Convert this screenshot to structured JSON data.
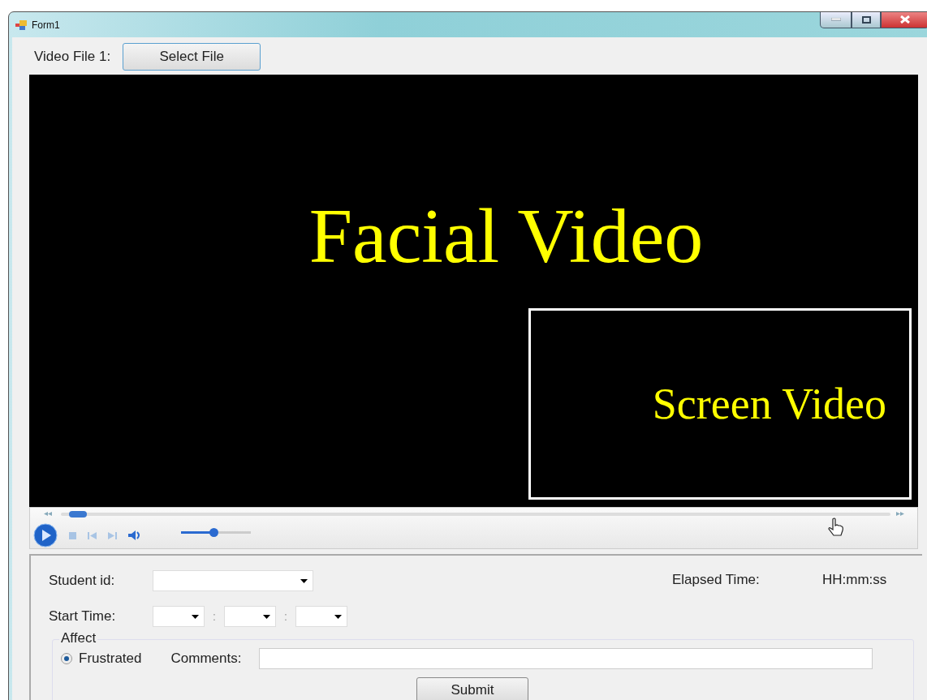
{
  "window": {
    "title": "Form1"
  },
  "file_row": {
    "label": "Video File 1:",
    "button": "Select File"
  },
  "video": {
    "main_label": "Facial Video",
    "inset_label": "Screen Video"
  },
  "player": {
    "seek": {
      "level": 0.01
    },
    "volume": {
      "level": 0.48
    }
  },
  "form": {
    "student_id": {
      "label": "Student id:"
    },
    "elapsed": {
      "label": "Elapsed Time:",
      "value": "HH:mm:ss"
    },
    "start_time": {
      "label": "Start Time:",
      "separators": [
        ":",
        ":"
      ]
    },
    "affect": {
      "title": "Affect",
      "options": [
        {
          "label": "Frustrated",
          "selected": true
        }
      ],
      "comments_label": "Comments:"
    },
    "submit": "Submit"
  }
}
